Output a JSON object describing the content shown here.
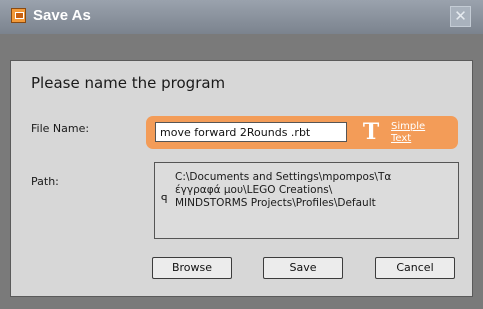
{
  "window": {
    "title": "Save As",
    "close_glyph": "✕",
    "app_icon": "app-icon"
  },
  "dialog": {
    "header": "Please name the program",
    "file_name_label": "File Name:",
    "file_name_value": "move forward 2Rounds .rbt",
    "font_icon_glyph": "T",
    "simple_text_link": "Simple\nText",
    "path_label": "Path:",
    "path_glyph": "ꟼ",
    "path_lines": [
      "C:\\Documents and Settings\\mpompos\\Τα",
      "έγγραφά μου\\LEGO Creations\\",
      "MINDSTORMS Projects\\Profiles\\Default"
    ]
  },
  "buttons": {
    "browse": "Browse",
    "save": "Save",
    "cancel": "Cancel"
  },
  "colors": {
    "accent": "#f39c58",
    "titlebar": "#8a929d",
    "panel": "#d7d7d7"
  }
}
